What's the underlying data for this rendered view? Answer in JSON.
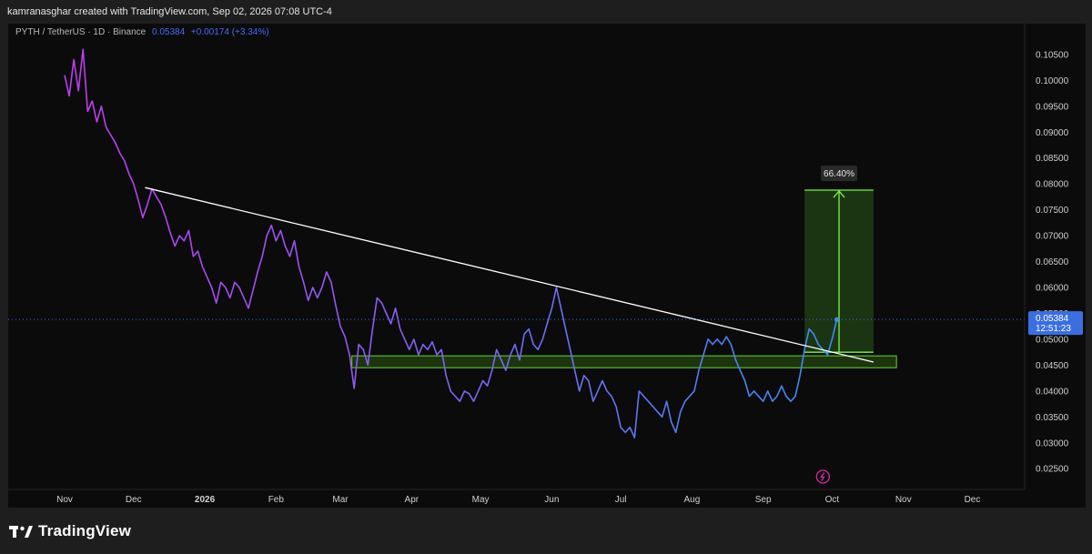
{
  "header": {
    "attribution": "kamranasghar created with TradingView.com, Sep 02, 2026 07:08 UTC-4"
  },
  "legend": {
    "symbol": "PYTH / TetherUS · 1D · Binance",
    "last": "0.05384",
    "change": "+0.00174 (+3.34%)"
  },
  "footer": {
    "brand": "TradingView"
  },
  "colors": {
    "background": "#0b0b0b",
    "line_start": "#c03cf0",
    "line_end": "#3d8cf0",
    "trendline": "#ffffff",
    "zone_fill": "#2d5a14",
    "zone_stroke": "#6ad23a",
    "target_fill": "#1d3a14",
    "target_stroke": "#7cf24a",
    "price_label": "#3b6fe0"
  },
  "chart_data": {
    "type": "line",
    "title": "",
    "xlabel": "",
    "ylabel": "",
    "x_ticks": [
      "Nov",
      "Dec",
      "2026",
      "Feb",
      "Mar",
      "Apr",
      "May",
      "Jun",
      "Jul",
      "Aug",
      "Sep",
      "Oct",
      "Nov",
      "Dec"
    ],
    "y_ticks": [
      "0.10500",
      "0.10000",
      "0.09500",
      "0.09000",
      "0.08500",
      "0.08000",
      "0.07500",
      "0.07000",
      "0.06500",
      "0.06000",
      "0.05500",
      "0.05000",
      "0.04500",
      "0.04000",
      "0.03500",
      "0.03000",
      "0.02500"
    ],
    "ylim": [
      0.021,
      0.1085
    ],
    "current_price": "0.05384",
    "countdown": "12:51:23",
    "series": [
      {
        "values": [
          [
            0,
            0.101
          ],
          [
            2,
            0.097
          ],
          [
            4,
            0.104
          ],
          [
            6,
            0.098
          ],
          [
            8,
            0.106
          ],
          [
            10,
            0.094
          ],
          [
            12,
            0.096
          ],
          [
            14,
            0.092
          ],
          [
            16,
            0.095
          ],
          [
            18,
            0.091
          ],
          [
            20,
            0.0895
          ],
          [
            22,
            0.088
          ],
          [
            24,
            0.086
          ],
          [
            26,
            0.0845
          ],
          [
            28,
            0.082
          ],
          [
            30,
            0.08
          ],
          [
            32,
            0.077
          ],
          [
            34,
            0.0735
          ],
          [
            36,
            0.076
          ],
          [
            38,
            0.079
          ],
          [
            40,
            0.0775
          ],
          [
            42,
            0.076
          ],
          [
            44,
            0.0735
          ],
          [
            46,
            0.0705
          ],
          [
            48,
            0.068
          ],
          [
            50,
            0.07
          ],
          [
            52,
            0.069
          ],
          [
            54,
            0.071
          ],
          [
            56,
            0.066
          ],
          [
            58,
            0.067
          ],
          [
            60,
            0.064
          ],
          [
            62,
            0.062
          ],
          [
            64,
            0.06
          ],
          [
            66,
            0.057
          ],
          [
            68,
            0.061
          ],
          [
            70,
            0.06
          ],
          [
            72,
            0.058
          ],
          [
            74,
            0.061
          ],
          [
            76,
            0.06
          ],
          [
            78,
            0.058
          ],
          [
            80,
            0.056
          ],
          [
            82,
            0.0595
          ],
          [
            84,
            0.063
          ],
          [
            86,
            0.066
          ],
          [
            88,
            0.07
          ],
          [
            90,
            0.072
          ],
          [
            92,
            0.069
          ],
          [
            94,
            0.071
          ],
          [
            96,
            0.068
          ],
          [
            98,
            0.066
          ],
          [
            100,
            0.069
          ],
          [
            102,
            0.064
          ],
          [
            104,
            0.061
          ],
          [
            106,
            0.0575
          ],
          [
            108,
            0.06
          ],
          [
            110,
            0.058
          ],
          [
            112,
            0.06
          ],
          [
            114,
            0.063
          ],
          [
            116,
            0.061
          ],
          [
            118,
            0.0565
          ],
          [
            120,
            0.0525
          ],
          [
            122,
            0.0505
          ],
          [
            124,
            0.047
          ],
          [
            126,
            0.0405
          ],
          [
            128,
            0.049
          ],
          [
            130,
            0.048
          ],
          [
            132,
            0.045
          ],
          [
            134,
            0.052
          ],
          [
            136,
            0.058
          ],
          [
            138,
            0.057
          ],
          [
            140,
            0.055
          ],
          [
            142,
            0.053
          ],
          [
            144,
            0.056
          ],
          [
            146,
            0.052
          ],
          [
            148,
            0.05
          ],
          [
            150,
            0.048
          ],
          [
            152,
            0.05
          ],
          [
            154,
            0.047
          ],
          [
            156,
            0.049
          ],
          [
            158,
            0.048
          ],
          [
            160,
            0.0495
          ],
          [
            162,
            0.047
          ],
          [
            164,
            0.048
          ],
          [
            166,
            0.043
          ],
          [
            168,
            0.04
          ],
          [
            170,
            0.039
          ],
          [
            172,
            0.038
          ],
          [
            174,
            0.04
          ],
          [
            176,
            0.0395
          ],
          [
            178,
            0.038
          ],
          [
            180,
            0.04
          ],
          [
            182,
            0.042
          ],
          [
            184,
            0.041
          ],
          [
            186,
            0.044
          ],
          [
            188,
            0.048
          ],
          [
            190,
            0.046
          ],
          [
            192,
            0.044
          ],
          [
            194,
            0.047
          ],
          [
            196,
            0.049
          ],
          [
            198,
            0.046
          ],
          [
            200,
            0.051
          ],
          [
            202,
            0.052
          ],
          [
            204,
            0.049
          ],
          [
            206,
            0.048
          ],
          [
            208,
            0.05
          ],
          [
            210,
            0.053
          ],
          [
            212,
            0.056
          ],
          [
            214,
            0.06
          ],
          [
            216,
            0.056
          ],
          [
            218,
            0.052
          ],
          [
            220,
            0.048
          ],
          [
            222,
            0.044
          ],
          [
            224,
            0.04
          ],
          [
            226,
            0.043
          ],
          [
            228,
            0.042
          ],
          [
            230,
            0.038
          ],
          [
            232,
            0.04
          ],
          [
            234,
            0.042
          ],
          [
            236,
            0.04
          ],
          [
            238,
            0.039
          ],
          [
            240,
            0.037
          ],
          [
            242,
            0.033
          ],
          [
            244,
            0.032
          ],
          [
            246,
            0.033
          ],
          [
            248,
            0.031
          ],
          [
            250,
            0.04
          ],
          [
            252,
            0.039
          ],
          [
            254,
            0.038
          ],
          [
            256,
            0.037
          ],
          [
            258,
            0.036
          ],
          [
            260,
            0.035
          ],
          [
            262,
            0.038
          ],
          [
            264,
            0.034
          ],
          [
            266,
            0.032
          ],
          [
            268,
            0.036
          ],
          [
            270,
            0.038
          ],
          [
            272,
            0.039
          ],
          [
            274,
            0.04
          ],
          [
            276,
            0.044
          ],
          [
            278,
            0.047
          ],
          [
            280,
            0.05
          ],
          [
            282,
            0.049
          ],
          [
            284,
            0.05
          ],
          [
            286,
            0.049
          ],
          [
            288,
            0.0505
          ],
          [
            290,
            0.049
          ],
          [
            292,
            0.046
          ],
          [
            294,
            0.044
          ],
          [
            296,
            0.042
          ],
          [
            298,
            0.039
          ],
          [
            300,
            0.04
          ],
          [
            302,
            0.039
          ],
          [
            304,
            0.038
          ],
          [
            306,
            0.04
          ],
          [
            308,
            0.038
          ],
          [
            310,
            0.039
          ],
          [
            312,
            0.041
          ],
          [
            314,
            0.039
          ],
          [
            316,
            0.038
          ],
          [
            318,
            0.039
          ],
          [
            320,
            0.043
          ],
          [
            322,
            0.048
          ],
          [
            324,
            0.052
          ],
          [
            326,
            0.051
          ],
          [
            328,
            0.049
          ],
          [
            330,
            0.048
          ],
          [
            332,
            0.047
          ],
          [
            334,
            0.05
          ],
          [
            336,
            0.0538
          ]
        ]
      }
    ],
    "annotations": {
      "trendline": {
        "from": [
          35,
          0.0793
        ],
        "to": [
          352,
          0.0456
        ]
      },
      "support_zone": {
        "x": [
          125,
          362
        ],
        "y": [
          0.0445,
          0.0468
        ]
      },
      "target_box": {
        "x": [
          322,
          352
        ],
        "y": [
          0.0475,
          0.0788
        ],
        "label": "66.40%"
      }
    }
  }
}
